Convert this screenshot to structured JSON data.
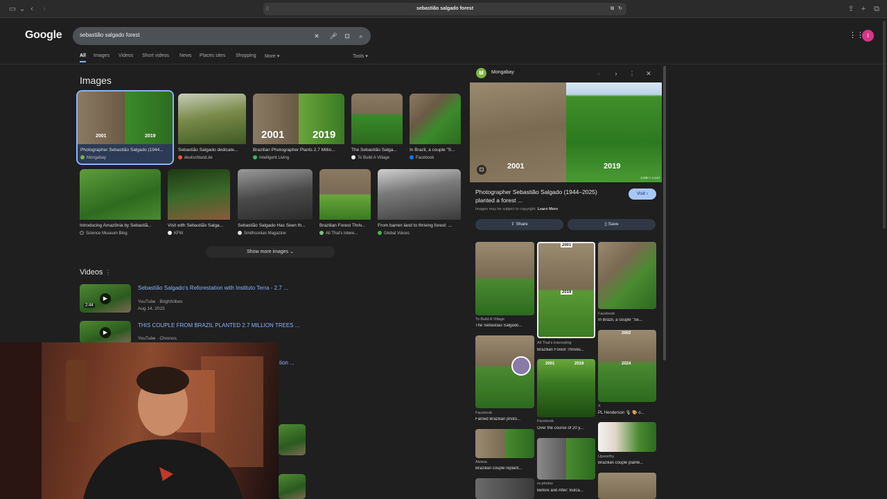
{
  "browser": {
    "url": "sebastião salgado forest",
    "icons": [
      "sidebar-icon",
      "chevron-down-icon",
      "back-icon",
      "forward-icon",
      "page-icon",
      "translate-icon",
      "reload-icon",
      "share-icon",
      "new-tab-icon",
      "tabs-icon"
    ]
  },
  "google": {
    "logo": "Google",
    "query": "sebastião salgado forest",
    "tabs": [
      "All",
      "Images",
      "Videos",
      "Short videos",
      "News",
      "Places sites",
      "Shopping",
      "More"
    ],
    "tools": "Tools",
    "avatar_letter": "t"
  },
  "images": {
    "heading": "Images",
    "row1": [
      {
        "caption": "Photographer Sebastião Salgado (1944...",
        "source": "Mongabay",
        "labels": [
          "2001",
          "2019"
        ]
      },
      {
        "caption": "Sebastião Salgado dedicate...",
        "source": "deutschland.de",
        "labels": []
      },
      {
        "caption": "Brazilian Photographer Plants 2.7 Millio...",
        "source": "Intelligent Living",
        "labels": [
          "2001",
          "2019"
        ]
      },
      {
        "caption": "The Sebastião Salga...",
        "source": "To Build A Village",
        "labels": []
      },
      {
        "caption": "In Brazil, a couple \"S...",
        "source": "Facebook",
        "labels": []
      }
    ],
    "row2": [
      {
        "caption": "Introducing Amazônia by Sebastiã...",
        "source": "Science Museum Blog"
      },
      {
        "caption": "Visit with Sebastião Salga...",
        "source": "KFW"
      },
      {
        "caption": "Sebastião Salgado Has Seen th...",
        "source": "Smithsonian Magazine"
      },
      {
        "caption": "Brazilian Forest Thriv...",
        "source": "All That's Intere..."
      },
      {
        "caption": "From barren land to thriving forest: ...",
        "source": "Global Voices"
      }
    ],
    "show_more": "Show more images"
  },
  "videos": {
    "heading": "Videos",
    "items": [
      {
        "title": "Sebastião Salgado's Reforestation with Instituto Terra - 2.7 ...",
        "meta": "YouTube · BrightVibes",
        "date": "Aug 14, 2023",
        "duration": "2:44"
      },
      {
        "title": "THIS COUPLE FROM BRAZIL PLANTED 2.7 MILLION TREES ...",
        "meta": "YouTube · Chronos",
        "date": "",
        "duration": ""
      }
    ],
    "partial_text": "tion ..."
  },
  "panel": {
    "source": "Mongabay",
    "source_letter": "M",
    "image_labels": [
      "2001",
      "2019"
    ],
    "dimensions": "2,000 × 1,144",
    "title": "Photographer Sebastião Salgado (1944–2025) planted a forest ...",
    "copyright_note": "Images may be subject to copyright.",
    "learn_more": "Learn More",
    "visit": "Visit",
    "share": "Share",
    "save": "Save",
    "related": [
      {
        "source": "To Build A Village",
        "caption": "The Sebastião Salgado..."
      },
      {
        "source": "",
        "caption": "",
        "labels": [
          "2001",
          "2019"
        ]
      },
      {
        "source": "Facebook",
        "caption": "In Brazil, a couple \"Se..."
      },
      {
        "source": "All That's Interesting",
        "caption": "Brazilian Forest Thrives..."
      },
      {
        "source": "",
        "caption": "",
        "labels": [
          "2002",
          "2024"
        ]
      },
      {
        "source": "Facebook",
        "caption": "Famed Brazilian photo..."
      },
      {
        "source": "Facebook",
        "caption": "Over the course of 20 y..."
      },
      {
        "source": "X",
        "caption": "PL Henderson 🎙 🎨 o..."
      },
      {
        "source": "Aleteia",
        "caption": "Brazilian couple replant..."
      },
      {
        "source": "Upworthy",
        "caption": "Brazilian couple plante..."
      },
      {
        "source": "re.photos",
        "caption": "Before and After: Bulcã..."
      }
    ],
    "grid_labels": [
      "2001",
      "2019"
    ]
  }
}
